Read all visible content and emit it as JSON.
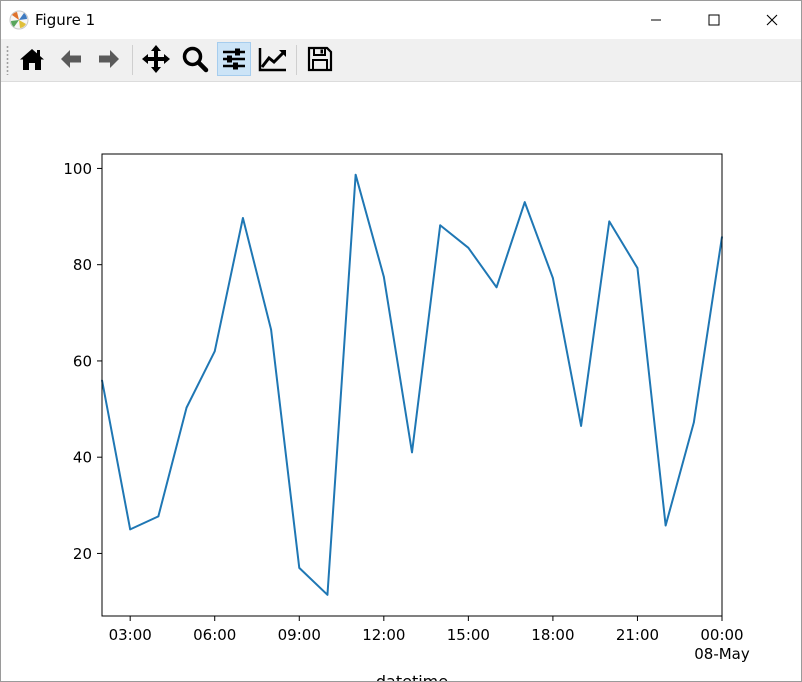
{
  "window": {
    "title": "Figure 1"
  },
  "toolbar": {
    "buttons": [
      {
        "name": "home",
        "icon": "home-icon"
      },
      {
        "name": "back",
        "icon": "arrow-left-icon"
      },
      {
        "name": "forward",
        "icon": "arrow-right-icon"
      },
      {
        "name": "pan",
        "icon": "move-icon"
      },
      {
        "name": "zoom",
        "icon": "magnifier-icon"
      },
      {
        "name": "configure-subplots",
        "icon": "sliders-icon",
        "active": true
      },
      {
        "name": "edit-axis",
        "icon": "line-chart-icon"
      },
      {
        "name": "save",
        "icon": "floppy-disk-icon"
      }
    ]
  },
  "chart_data": {
    "type": "line",
    "xlabel": "datetime",
    "ylabel": "",
    "color": "#1f77b4",
    "x": [
      "02:00",
      "03:00",
      "04:00",
      "05:00",
      "06:00",
      "07:00",
      "08:00",
      "09:00",
      "10:00",
      "11:00",
      "12:00",
      "13:00",
      "14:00",
      "15:00",
      "16:00",
      "17:00",
      "18:00",
      "19:00",
      "20:00",
      "21:00",
      "22:00",
      "23:00",
      "00:00"
    ],
    "values": [
      56,
      25,
      27.7,
      50.3,
      62,
      89.7,
      66.5,
      17,
      11.4,
      98.7,
      77.5,
      41,
      88.2,
      83.5,
      75.3,
      93,
      77.2,
      46.5,
      89,
      79.3,
      25.8,
      47.2,
      85.8
    ],
    "xlim": [
      "02:00",
      "00:00"
    ],
    "ylim": [
      7,
      103
    ],
    "yticks": [
      20,
      40,
      60,
      80,
      100
    ],
    "xticks": [
      {
        "at": "03:00",
        "label": "03:00"
      },
      {
        "at": "06:00",
        "label": "06:00"
      },
      {
        "at": "09:00",
        "label": "09:00"
      },
      {
        "at": "12:00",
        "label": "12:00"
      },
      {
        "at": "15:00",
        "label": "15:00"
      },
      {
        "at": "18:00",
        "label": "18:00"
      },
      {
        "at": "21:00",
        "label": "21:00"
      },
      {
        "at": "00:00",
        "label": "00:00",
        "sublabel": "08-May"
      }
    ],
    "grid": false
  }
}
